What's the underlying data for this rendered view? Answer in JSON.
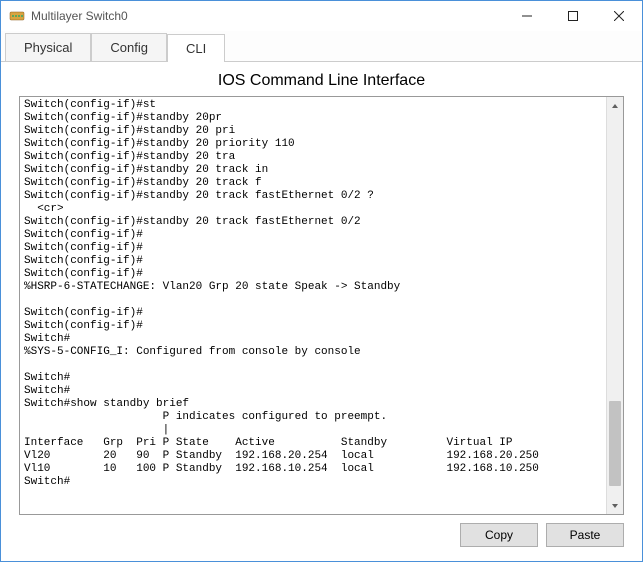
{
  "window": {
    "title": "Multilayer Switch0"
  },
  "tabs": {
    "physical": "Physical",
    "config": "Config",
    "cli": "CLI"
  },
  "page_title": "IOS Command Line Interface",
  "buttons": {
    "copy": "Copy",
    "paste": "Paste"
  },
  "cli_output": "Switch(config-if)#st\nSwitch(config-if)#standby 20pr\nSwitch(config-if)#standby 20 pri\nSwitch(config-if)#standby 20 priority 110\nSwitch(config-if)#standby 20 tra\nSwitch(config-if)#standby 20 track in\nSwitch(config-if)#standby 20 track f\nSwitch(config-if)#standby 20 track fastEthernet 0/2 ?\n  <cr>\nSwitch(config-if)#standby 20 track fastEthernet 0/2\nSwitch(config-if)#\nSwitch(config-if)#\nSwitch(config-if)#\nSwitch(config-if)#\n%HSRP-6-STATECHANGE: Vlan20 Grp 20 state Speak -> Standby\n\nSwitch(config-if)#\nSwitch(config-if)#\nSwitch#\n%SYS-5-CONFIG_I: Configured from console by console\n\nSwitch#\nSwitch#\nSwitch#show standby brief\n                     P indicates configured to preempt.\n                     |\nInterface   Grp  Pri P State    Active          Standby         Virtual IP\nVl20        20   90  P Standby  192.168.20.254  local           192.168.20.250\nVl10        10   100 P Standby  192.168.10.254  local           192.168.10.250\nSwitch#"
}
